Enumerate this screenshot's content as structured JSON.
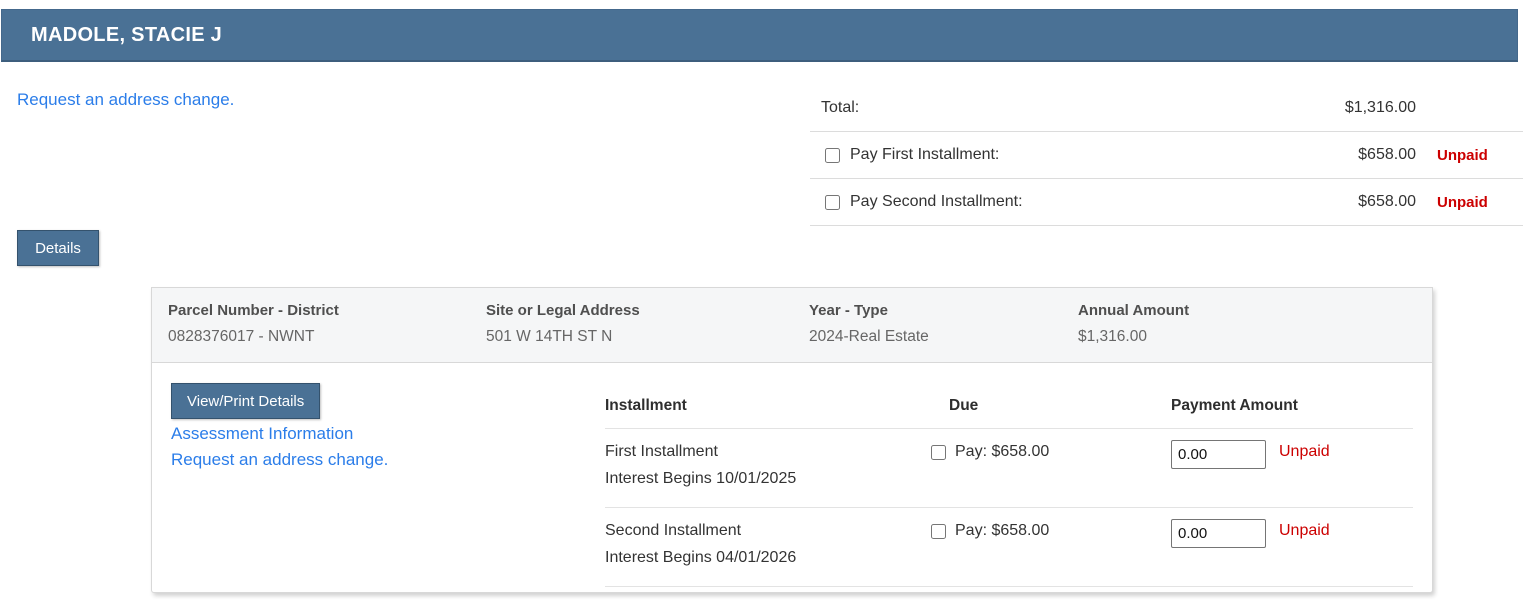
{
  "header": {
    "title": "MADOLE, STACIE J"
  },
  "links": {
    "address_change": "Request an address change."
  },
  "summary": {
    "total_label": "Total:",
    "total_value": "$1,316.00",
    "rows": [
      {
        "label": "Pay First Installment:",
        "amount": "$658.00",
        "status": "Unpaid"
      },
      {
        "label": "Pay Second Installment:",
        "amount": "$658.00",
        "status": "Unpaid"
      }
    ]
  },
  "details_button": "Details",
  "panel": {
    "info": [
      {
        "label": "Parcel Number - District",
        "value": "0828376017 - NWNT"
      },
      {
        "label": "Site or Legal Address",
        "value": "501 W 14TH ST N"
      },
      {
        "label": "Year - Type",
        "value": "2024-Real Estate"
      },
      {
        "label": "Annual Amount",
        "value": "$1,316.00"
      }
    ],
    "view_print_button": "View/Print Details",
    "links": [
      "Assessment Information",
      "Request an address change."
    ],
    "table": {
      "headers": [
        "Installment",
        "Due",
        "Payment Amount"
      ],
      "rows": [
        {
          "name": "First Installment",
          "interest": "Interest Begins 10/01/2025",
          "pay_label": "Pay: $658.00",
          "payment_value": "0.00",
          "status": "Unpaid"
        },
        {
          "name": "Second Installment",
          "interest": "Interest Begins 04/01/2026",
          "pay_label": "Pay: $658.00",
          "payment_value": "0.00",
          "status": "Unpaid"
        }
      ]
    }
  },
  "colors": {
    "accent": "#4a7195",
    "link": "#2b7de9",
    "unpaid": "#cc0000",
    "panel_header_bg": "#f5f6f7"
  }
}
